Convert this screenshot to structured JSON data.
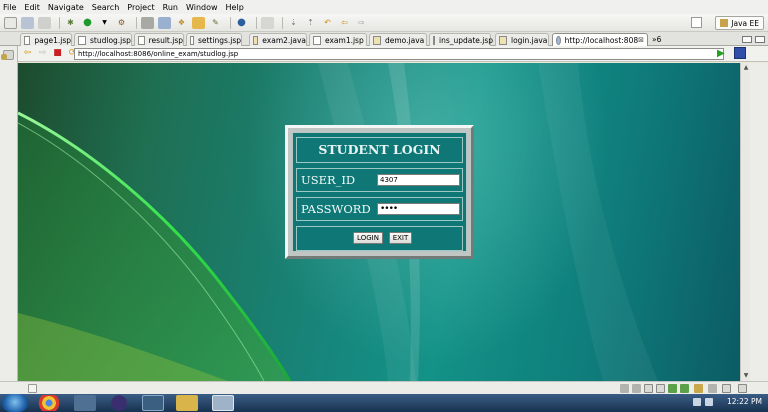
{
  "menu": [
    "File",
    "Edit",
    "Navigate",
    "Search",
    "Project",
    "Run",
    "Window",
    "Help"
  ],
  "perspective": "Java EE",
  "tabs": [
    {
      "label": "page1.jsp"
    },
    {
      "label": "studlog.jsp"
    },
    {
      "label": "result.jsp"
    },
    {
      "label": "settings.jsp"
    },
    {
      "label": "exam2.java"
    },
    {
      "label": "exam1.jsp"
    },
    {
      "label": "demo.java"
    },
    {
      "label": "ins_update.jsp"
    },
    {
      "label": "login.java"
    },
    {
      "label": "http://localhost:808",
      "active": true
    }
  ],
  "tabs_overflow": "»6",
  "browser": {
    "url": "http://localhost:8086/online_exam/studlog.jsp"
  },
  "login": {
    "title": "STUDENT LOGIN",
    "user_label": "USER_ID",
    "user_value": "4307",
    "password_label": "PASSWORD",
    "password_value": "••••",
    "login_button": "LOGIN",
    "exit_button": "EXIT"
  },
  "taskbar": {
    "clock": "12:22 PM"
  },
  "colors": {
    "login_panel": "#0f7877",
    "page_teal": "#139287",
    "accent_green": "#33e24a"
  }
}
